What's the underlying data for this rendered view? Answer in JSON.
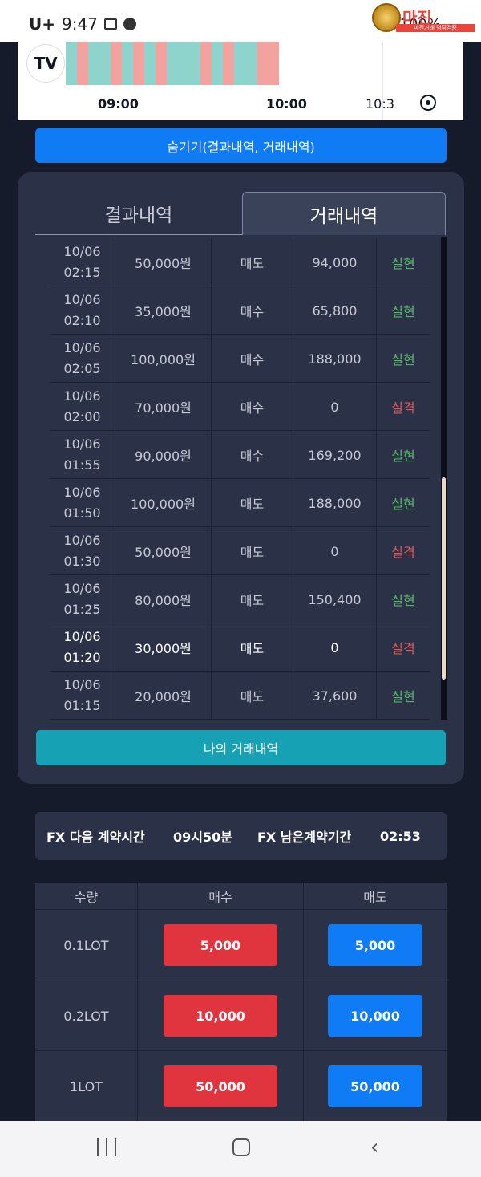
{
  "status_bar": {
    "carrier": "U+",
    "time": "9:47",
    "battery": "100%",
    "watermark_text": "마진",
    "watermark_sub": "마진거래 먹튀검증"
  },
  "chart": {
    "logo_text": "TV",
    "time_labels": [
      "09:00",
      "10:00",
      "10:3"
    ],
    "bar_colors": [
      "teal",
      "pink",
      "teal",
      "teal",
      "pink",
      "teal",
      "pink",
      "teal",
      "pink",
      "teal",
      "teal",
      "teal",
      "pink",
      "teal",
      "pink",
      "teal",
      "teal",
      "pink",
      "pink"
    ],
    "colors": {
      "teal": "#8fd3cd",
      "pink": "#f2a3a0"
    }
  },
  "hide_button": {
    "label": "숨기기(결과내역, 거래내역)"
  },
  "history": {
    "tabs": [
      {
        "label": "결과내역",
        "active": false
      },
      {
        "label": "거래내역",
        "active": true
      }
    ],
    "rows": [
      {
        "date": "10/06",
        "time": "02:15",
        "amount": "50,000원",
        "side": "매도",
        "payout": "94,000",
        "result": "실현"
      },
      {
        "date": "10/06",
        "time": "02:10",
        "amount": "35,000원",
        "side": "매수",
        "payout": "65,800",
        "result": "실현"
      },
      {
        "date": "10/06",
        "time": "02:05",
        "amount": "100,000원",
        "side": "매수",
        "payout": "188,000",
        "result": "실현"
      },
      {
        "date": "10/06",
        "time": "02:00",
        "amount": "70,000원",
        "side": "매수",
        "payout": "0",
        "result": "실격"
      },
      {
        "date": "10/06",
        "time": "01:55",
        "amount": "90,000원",
        "side": "매수",
        "payout": "169,200",
        "result": "실현"
      },
      {
        "date": "10/06",
        "time": "01:50",
        "amount": "100,000원",
        "side": "매도",
        "payout": "188,000",
        "result": "실현"
      },
      {
        "date": "10/06",
        "time": "01:30",
        "amount": "50,000원",
        "side": "매도",
        "payout": "0",
        "result": "실격"
      },
      {
        "date": "10/06",
        "time": "01:25",
        "amount": "80,000원",
        "side": "매도",
        "payout": "150,400",
        "result": "실현"
      },
      {
        "date": "10/06",
        "time": "01:20",
        "amount": "30,000원",
        "side": "매도",
        "payout": "0",
        "result": "실격"
      },
      {
        "date": "10/06",
        "time": "01:15",
        "amount": "20,000원",
        "side": "매도",
        "payout": "37,600",
        "result": "실현"
      }
    ],
    "my_trades_label": "나의 거래내역",
    "colors": {
      "win": "#57b86a",
      "lose": "#e25656"
    }
  },
  "contract": {
    "next_label": "FX 다음 계약시간",
    "next_value": "09시50분",
    "remain_label": "FX 남은계약기간",
    "remain_value": "02:53"
  },
  "order": {
    "headers": [
      "수량",
      "매수",
      "매도"
    ],
    "rows": [
      {
        "lot": "0.1LOT",
        "buy": "5,000",
        "sell": "5,000"
      },
      {
        "lot": "0.2LOT",
        "buy": "10,000",
        "sell": "10,000"
      },
      {
        "lot": "1LOT",
        "buy": "50,000",
        "sell": "50,000"
      }
    ],
    "colors": {
      "buy": "#e0353f",
      "sell": "#0f7cf6"
    }
  }
}
